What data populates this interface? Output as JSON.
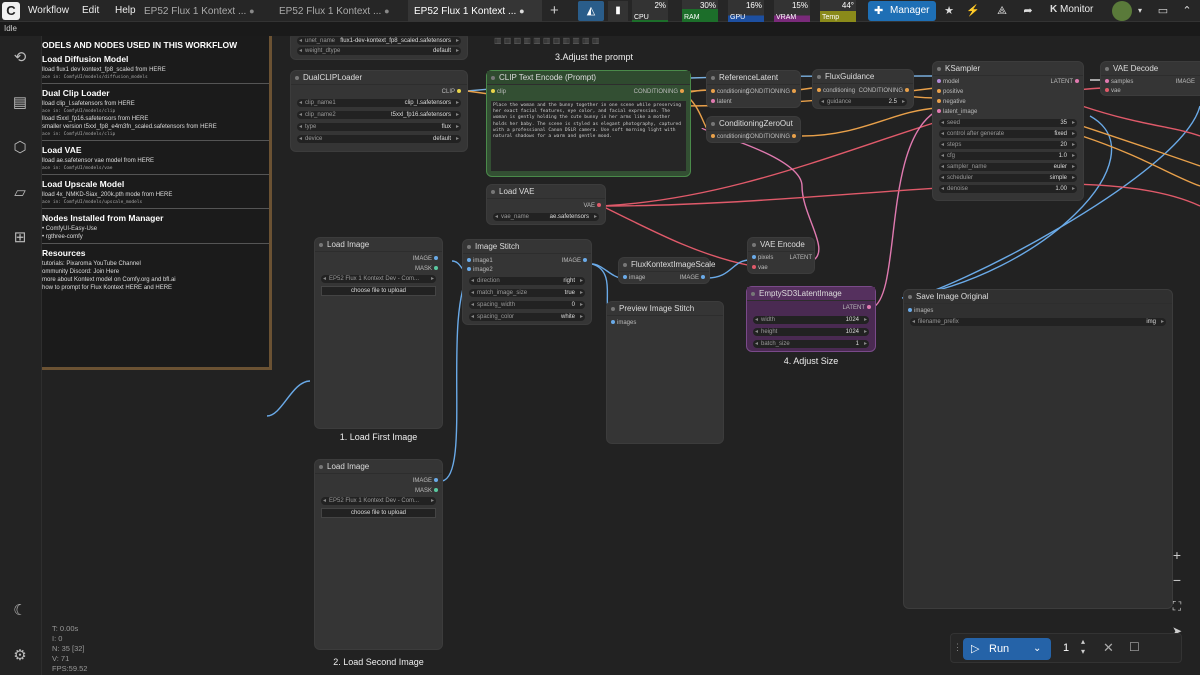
{
  "app": {
    "logo": "C",
    "menu": [
      "Workflow",
      "Edit",
      "Help"
    ]
  },
  "tabs": [
    {
      "label": "EP52 Flux 1 Kontext ...",
      "active": false
    },
    {
      "label": "EP52 Flux 1 Kontext ...",
      "active": false
    },
    {
      "label": "EP52 Flux 1 Kontext ...",
      "active": true
    }
  ],
  "stats": [
    {
      "label": "CPU",
      "value": "2%"
    },
    {
      "label": "RAM",
      "value": "30%"
    },
    {
      "label": "GPU",
      "value": "16%"
    },
    {
      "label": "VRAM",
      "value": "15%"
    },
    {
      "label": "Temp",
      "value": "44°"
    }
  ],
  "manager_label": "Manager",
  "monitor_label": "Monitor",
  "status": "Idle",
  "notes": {
    "title": "ODELS AND NODES USED IN THIS WORKFLOW",
    "sections": [
      {
        "heading": "Load Diffusion Model",
        "lines": [
          "lload flux1 dev kontext_fp8_scaled from HERE"
        ],
        "mono": "ace in: ComfyUI/models/diffusion_models"
      },
      {
        "heading": "Dual Clip Loader",
        "lines": [
          "lload clip_l.safetensors from HERE"
        ],
        "mono": "ace in: ComfyUI/models/clip",
        "lines2": [
          "lload t5xxl_fp16.safetensors from HERE",
          "smaller version t5xxl_fp8_e4m3fn_scaled.safetensors from HERE"
        ],
        "mono2": "ace in: ComfyUI/models/clip"
      },
      {
        "heading": "Load VAE",
        "lines": [
          "lload ae.safetensor vae model from HERE"
        ],
        "mono": "ace in: ComfyUI/models/vae"
      },
      {
        "heading": "Load Upscale Model",
        "lines": [
          "lload 4x_NMKD-Siax_200k.pth mode from HERE"
        ],
        "mono": "ace in: ComfyUI/models/upscale_models"
      },
      {
        "heading": "Nodes Installed from Manager",
        "lines": [
          "• ComfyUI-Easy-Use",
          "• rgthree-comfy"
        ]
      },
      {
        "heading": "Resources",
        "lines": [
          "tutorials: Pixaroma YouTube Channel",
          "ommunity Discord: Join Here",
          "more about Kontext model on Comfy.org and bfl.ai",
          "how to prompt for Flux Kontext HERE and HERE"
        ]
      }
    ]
  },
  "nodes": {
    "unet": {
      "w1_label": "unet_name",
      "w1_value": "flux1-dev-kontext_fp8_scaled.safetensors",
      "w2_label": "weight_dtype",
      "w2_value": "default"
    },
    "dualclip": {
      "title": "DualCLIPLoader",
      "out": "CLIP",
      "w": [
        {
          "l": "clip_name1",
          "v": "clip_l.safetensors"
        },
        {
          "l": "clip_name2",
          "v": "t5xxl_fp16.safetensors"
        },
        {
          "l": "type",
          "v": "flux"
        },
        {
          "l": "device",
          "v": "default"
        }
      ]
    },
    "clipenc": {
      "title": "CLIP Text Encode (Prompt)",
      "in": "clip",
      "out": "CONDITIONING",
      "prompt": "Place the woman and the bunny together in one scene while preserving her exact facial features, eye color, and facial expression. The woman is gently holding the cute bunny in her arms like a mother holds her baby. The scene is styled as elegant photography, captured with a professional Canon DSLR camera. Use soft morning light with natural shadows for a warm and gentle mood."
    },
    "reflatent": {
      "title": "ReferenceLatent",
      "in1": "conditioning",
      "in2": "latent",
      "out": "CONDITIONING"
    },
    "zeroout": {
      "title": "ConditioningZeroOut",
      "in": "conditioning",
      "out": "CONDITIONING"
    },
    "guidance": {
      "title": "FluxGuidance",
      "in": "conditioning",
      "out": "CONDITIONING",
      "w_label": "guidance",
      "w_value": "2.5"
    },
    "ksampler": {
      "title": "KSampler",
      "ins": [
        "model",
        "positive",
        "negative",
        "latent_image"
      ],
      "out": "LATENT",
      "w": [
        {
          "l": "seed",
          "v": "35"
        },
        {
          "l": "control after generate",
          "v": "fixed"
        },
        {
          "l": "steps",
          "v": "20"
        },
        {
          "l": "cfg",
          "v": "1.0"
        },
        {
          "l": "sampler_name",
          "v": "euler"
        },
        {
          "l": "scheduler",
          "v": "simple"
        },
        {
          "l": "denoise",
          "v": "1.00"
        }
      ]
    },
    "vaedecode": {
      "title": "VAE Decode",
      "ins": [
        "samples",
        "vae"
      ],
      "out": "IMAGE"
    },
    "loadvae": {
      "title": "Load VAE",
      "out": "VAE",
      "w_label": "vae_name",
      "w_value": "ae.safetensors"
    },
    "loadimg1": {
      "title": "Load Image",
      "out1": "IMAGE",
      "out2": "MASK",
      "file": "EP52 Flux 1 Kontext Dev - Com...",
      "btn": "choose file to upload"
    },
    "loadimg2": {
      "title": "Load Image",
      "out1": "IMAGE",
      "out2": "MASK",
      "file": "EP52 Flux 1 Kontext Dev - Com...",
      "btn": "choose file to upload"
    },
    "stitch": {
      "title": "Image Stitch",
      "ins": [
        "image1",
        "image2"
      ],
      "out": "IMAGE",
      "w": [
        {
          "l": "direction",
          "v": "right"
        },
        {
          "l": "match_image_size",
          "v": "true"
        },
        {
          "l": "spacing_width",
          "v": "0"
        },
        {
          "l": "spacing_color",
          "v": "white"
        }
      ]
    },
    "scale": {
      "title": "FluxKontextImageScale",
      "in": "image",
      "out": "IMAGE"
    },
    "preview": {
      "title": "Preview Image Stitch",
      "in": "images"
    },
    "vaeencode": {
      "title": "VAE Encode",
      "ins": [
        "pixels",
        "vae"
      ],
      "out": "LATENT"
    },
    "emptylatent": {
      "title": "EmptySD3LatentImage",
      "out": "LATENT",
      "w": [
        {
          "l": "width",
          "v": "1024"
        },
        {
          "l": "height",
          "v": "1024"
        },
        {
          "l": "batch_size",
          "v": "1"
        }
      ]
    },
    "save": {
      "title": "Save Image Original",
      "in": "images",
      "w_label": "filename_prefix",
      "w_value": "img"
    }
  },
  "captions": {
    "prompt": "3.Adjust the prompt",
    "first": "1. Load First Image",
    "second": "2. Load Second Image",
    "size": "4. Adjust Size"
  },
  "perf": {
    "t": "T: 0.00s",
    "i": "I: 0",
    "n": "N: 35 [32]",
    "v": "V: 71",
    "fps": "FPS:59.52"
  },
  "run": {
    "label": "Run",
    "count": "1"
  }
}
